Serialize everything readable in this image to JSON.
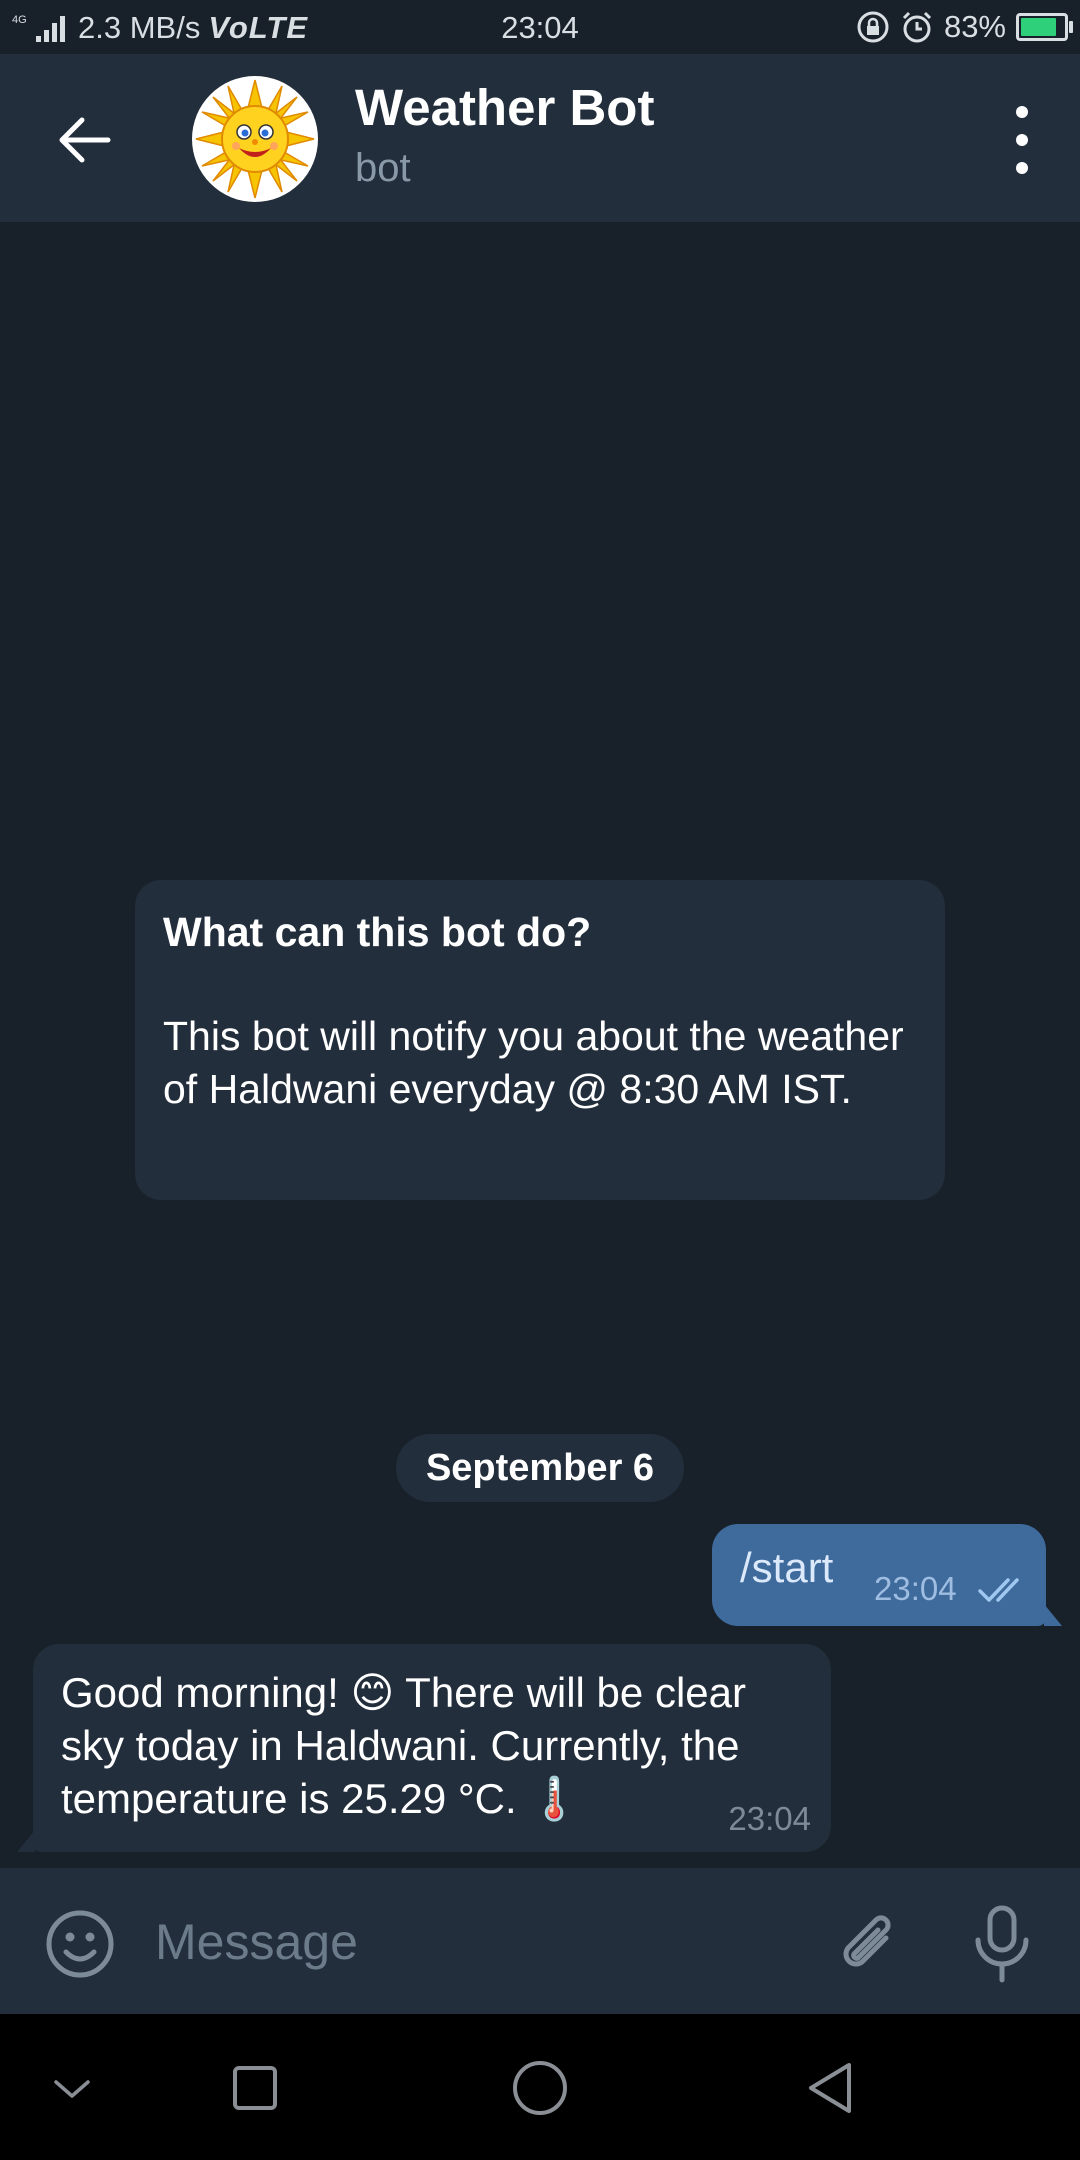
{
  "status_bar": {
    "network": "4G",
    "speed": "2.3 MB/s",
    "volte": "VoLTE",
    "time": "23:04",
    "battery": "83%",
    "battery_level": 0.83
  },
  "header": {
    "title": "Weather Bot",
    "subtitle": "bot"
  },
  "intro": {
    "title": "What can this bot do?",
    "body": "This bot will notify you about the weather of Haldwani everyday @ 8:30 AM IST."
  },
  "date_chip": "September 6",
  "messages": [
    {
      "direction": "out",
      "text": "/start",
      "time": "23:04",
      "status": "read"
    },
    {
      "direction": "in",
      "text": "Good morning! 😊 There will be clear sky today in Haldwani. Currently, the temperature is 25.29 °C. 🌡️",
      "time": "23:04"
    }
  ],
  "input": {
    "placeholder": "Message"
  },
  "colors": {
    "background": "#18202a",
    "header": "#232e3c",
    "outgoing_bubble": "#3e6a9c",
    "incoming_bubble": "#232e3c",
    "battery_fill": "#2ed17a"
  },
  "icons": {
    "back": "arrow-left-icon",
    "menu": "more-vertical-icon",
    "emoji": "smiley-icon",
    "attach": "paperclip-icon",
    "mic": "microphone-icon",
    "read": "double-check-icon",
    "alarm": "alarm-clock-icon",
    "rotation_lock": "rotation-lock-icon",
    "nav_collapse": "chevron-down-icon",
    "nav_recents": "square-icon",
    "nav_home": "circle-icon",
    "nav_back": "triangle-back-icon"
  }
}
